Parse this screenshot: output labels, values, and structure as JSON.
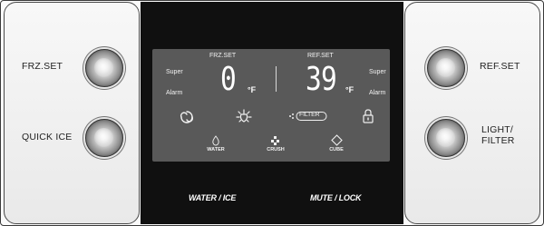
{
  "left_panel": {
    "frz_set_label": "FRZ.SET",
    "quick_ice_label": "QUICK ICE"
  },
  "right_panel": {
    "ref_set_label": "REF.SET",
    "light_filter_label_1": "LIGHT/",
    "light_filter_label_2": "FILTER"
  },
  "display": {
    "freezer": {
      "header": "FRZ.SET",
      "super_label": "Super",
      "alarm_label": "Alarm",
      "temperature": "0",
      "unit": "°F"
    },
    "fridge": {
      "header": "REF.SET",
      "super_label": "Super",
      "alarm_label": "Alarm",
      "temperature": "39",
      "unit": "°F"
    },
    "filter_label": "FILTER",
    "water_label": "WATER",
    "crush_label": "CRUSH",
    "cube_label": "CUBE",
    "icons": [
      "fan-icon",
      "light-bulb-icon",
      "filter-icon",
      "lock-icon",
      "water-drop-icon",
      "crushed-ice-icon",
      "ice-cube-icon"
    ]
  },
  "center_buttons": {
    "water_ice_label": "WATER / ICE",
    "mute_lock_label": "MUTE / LOCK"
  },
  "colors": {
    "lcd_background": "#595959",
    "panel_background": "#101010",
    "segment_color": "#ffffff"
  }
}
